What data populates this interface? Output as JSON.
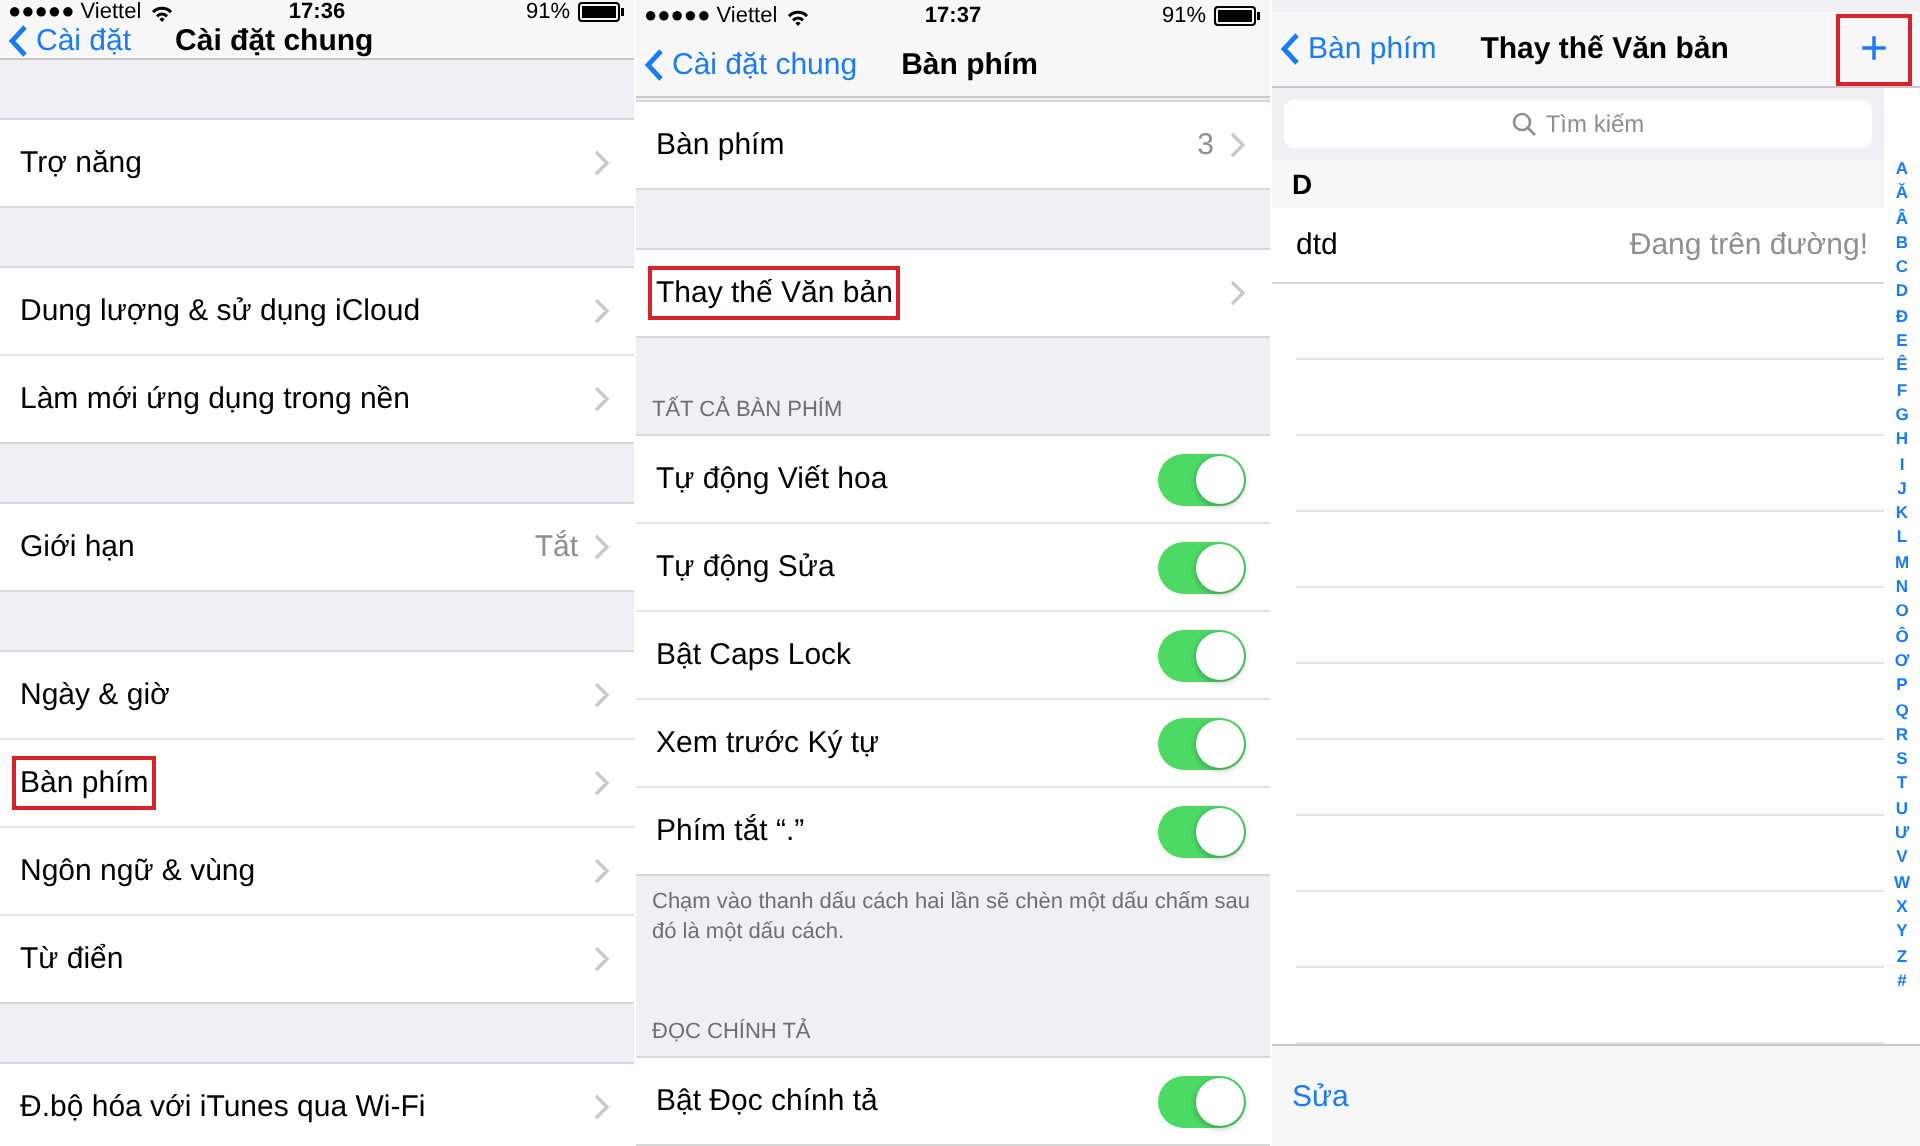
{
  "screens": [
    {
      "status_bar": {
        "carrier": "●●●●● Viettel",
        "time": "17:36",
        "battery": "91%"
      },
      "nav": {
        "back": "Cài đặt",
        "title": "Cài đặt chung"
      },
      "sections": [
        {
          "rows": [
            {
              "kind": "disclosure",
              "label": "Trợ năng",
              "highlighted": false
            }
          ]
        },
        {
          "rows": [
            {
              "kind": "disclosure",
              "label": "Dung lượng & sử dụng iCloud",
              "highlighted": false
            },
            {
              "kind": "disclosure",
              "label": "Làm mới ứng dụng trong nền",
              "highlighted": false
            }
          ]
        },
        {
          "rows": [
            {
              "kind": "disclosure",
              "label": "Giới hạn",
              "value": "Tắt",
              "highlighted": false
            }
          ]
        },
        {
          "rows": [
            {
              "kind": "disclosure",
              "label": "Ngày & giờ",
              "highlighted": false
            },
            {
              "kind": "disclosure",
              "label": "Bàn phím",
              "highlighted": true
            },
            {
              "kind": "disclosure",
              "label": "Ngôn ngữ & vùng",
              "highlighted": false
            },
            {
              "kind": "disclosure",
              "label": "Từ điển",
              "highlighted": false
            }
          ]
        },
        {
          "rows": [
            {
              "kind": "disclosure",
              "label": "Đ.bộ hóa với iTunes qua Wi-Fi",
              "highlighted": false
            }
          ]
        }
      ]
    },
    {
      "status_bar": {
        "carrier": "●●●●● Viettel",
        "time": "17:37",
        "battery": "91%"
      },
      "nav": {
        "back": "Cài đặt chung",
        "title": "Bàn phím"
      },
      "sections": [
        {
          "rows": [
            {
              "kind": "disclosure",
              "label": "Bàn phím",
              "value": "3",
              "highlighted": false
            }
          ]
        },
        {
          "rows": [
            {
              "kind": "disclosure",
              "label": "Thay thế Văn bản",
              "highlighted": true
            }
          ]
        },
        {
          "header": "TẤT CẢ BÀN PHÍM",
          "footer": "Chạm vào thanh dấu cách hai lần sẽ chèn một dấu chấm sau đó là một dấu cách.",
          "rows": [
            {
              "kind": "toggle",
              "label": "Tự động Viết hoa",
              "on": true,
              "highlighted": false
            },
            {
              "kind": "toggle",
              "label": "Tự động Sửa",
              "on": true,
              "highlighted": false
            },
            {
              "kind": "toggle",
              "label": "Bật Caps Lock",
              "on": true,
              "highlighted": false
            },
            {
              "kind": "toggle",
              "label": "Xem trước Ký tự",
              "on": true,
              "highlighted": false
            },
            {
              "kind": "toggle",
              "label": "Phím tắt “.”",
              "on": true,
              "highlighted": false
            }
          ]
        },
        {
          "header": "ĐỌC CHÍNH TẢ",
          "rows": [
            {
              "kind": "toggle",
              "label": "Bật Đọc chính tả",
              "on": true,
              "highlighted": false
            }
          ]
        }
      ]
    },
    {
      "nav": {
        "back": "Bàn phím",
        "title": "Thay thế Văn bản",
        "add": "+",
        "add_highlighted": true
      },
      "search": {
        "placeholder": "Tìm kiếm"
      },
      "list": {
        "header": "D",
        "rows": [
          {
            "phrase": "dtd",
            "replacement": "Đang trên đường!"
          }
        ]
      },
      "index": [
        "A",
        "Ă",
        "Â",
        "B",
        "C",
        "D",
        "Đ",
        "E",
        "Ê",
        "F",
        "G",
        "H",
        "I",
        "J",
        "K",
        "L",
        "M",
        "N",
        "O",
        "Ô",
        "Ơ",
        "P",
        "Q",
        "R",
        "S",
        "T",
        "U",
        "Ư",
        "V",
        "W",
        "X",
        "Y",
        "Z",
        "#"
      ],
      "toolbar": {
        "edit": "Sửa"
      }
    }
  ]
}
